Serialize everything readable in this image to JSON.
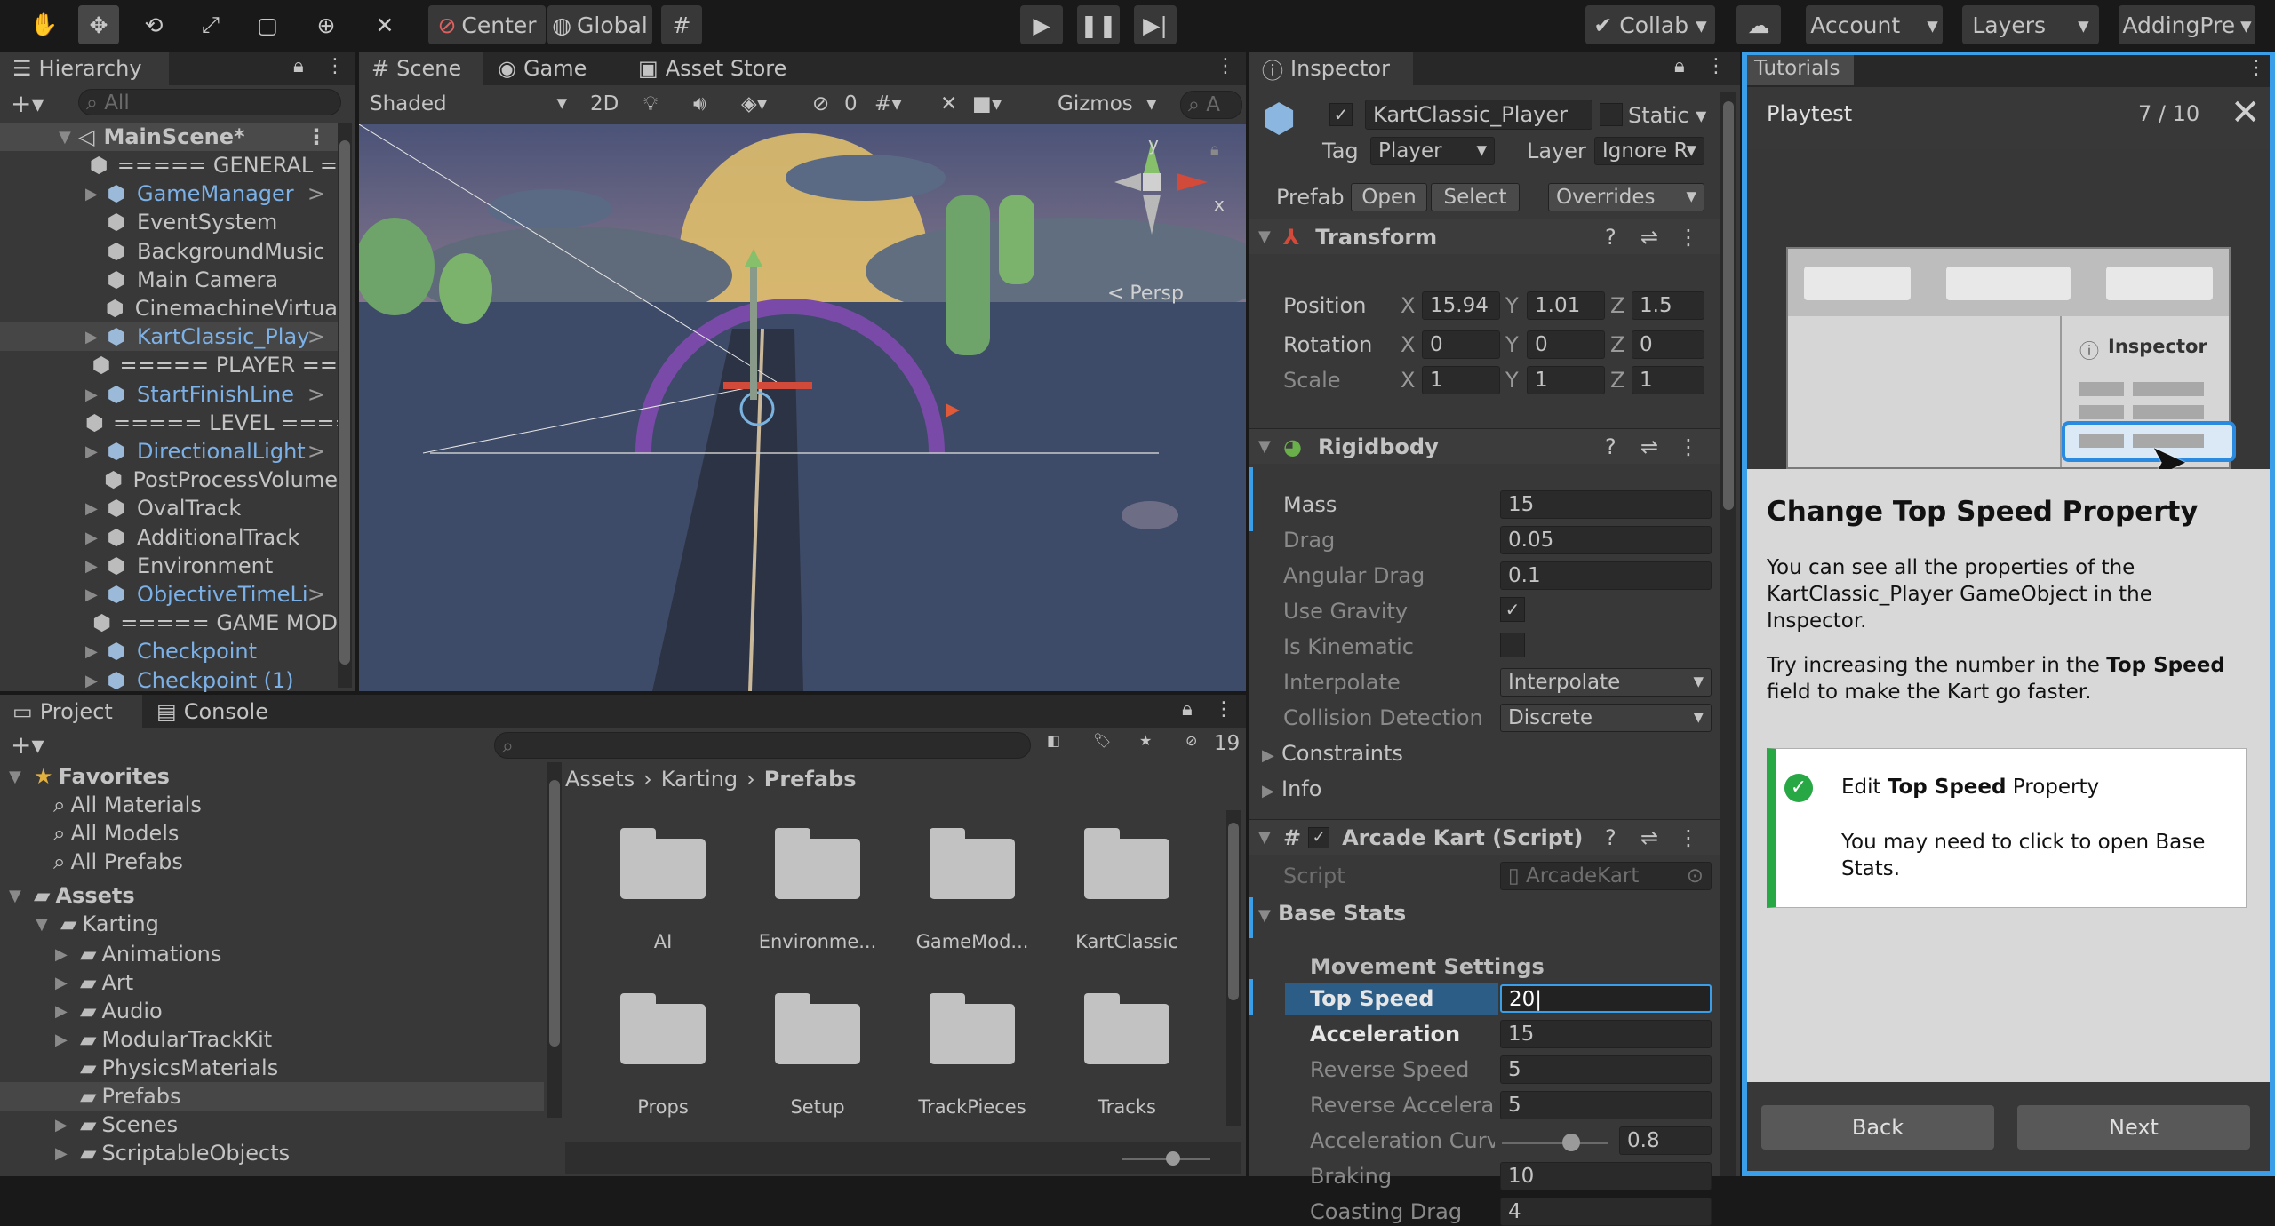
{
  "toolbar": {
    "center_label": "Center",
    "global_label": "Global",
    "collab_label": "Collab",
    "account_label": "Account",
    "layers_label": "Layers",
    "layout_label": "AddingPre"
  },
  "hierarchy": {
    "tab_label": "Hierarchy",
    "search_placeholder": "All",
    "scene_name": "MainScene*",
    "items": [
      {
        "label": "===== GENERAL =",
        "blue": false
      },
      {
        "label": "GameManager",
        "blue": true
      },
      {
        "label": "EventSystem",
        "blue": false
      },
      {
        "label": "BackgroundMusic",
        "blue": false
      },
      {
        "label": "Main Camera",
        "blue": false
      },
      {
        "label": "CinemachineVirtua",
        "blue": false
      },
      {
        "label": "KartClassic_Play",
        "blue": true
      },
      {
        "label": "===== PLAYER ==",
        "blue": false
      },
      {
        "label": "StartFinishLine",
        "blue": true
      },
      {
        "label": "===== LEVEL ====",
        "blue": false
      },
      {
        "label": "DirectionalLight",
        "blue": true
      },
      {
        "label": "PostProcessVolume",
        "blue": false
      },
      {
        "label": "OvalTrack",
        "blue": false
      },
      {
        "label": "AdditionalTrack",
        "blue": false
      },
      {
        "label": "Environment",
        "blue": false
      },
      {
        "label": "ObjectiveTimeLi",
        "blue": true
      },
      {
        "label": "===== GAME MOD",
        "blue": false
      },
      {
        "label": "Checkpoint",
        "blue": true
      },
      {
        "label": "Checkpoint (1)",
        "blue": true
      }
    ]
  },
  "scene": {
    "tab_scene": "Scene",
    "tab_game": "Game",
    "tab_asset_store": "Asset Store",
    "shading": "Shaded",
    "mode_2d": "2D",
    "hidden_count": "0",
    "gizmos": "Gizmos",
    "search_placeholder": "A",
    "persp": "< Persp",
    "axis_x": "x",
    "axis_y": "y"
  },
  "project": {
    "tab_project": "Project",
    "tab_console": "Console",
    "count": "19",
    "favorites_label": "Favorites",
    "favorites": [
      "All Materials",
      "All Models",
      "All Prefabs"
    ],
    "assets_label": "Assets",
    "karting_label": "Karting",
    "karting_children": [
      "Animations",
      "Art",
      "Audio",
      "ModularTrackKit",
      "PhysicsMaterials",
      "Prefabs",
      "Scenes",
      "ScriptableObjects"
    ],
    "breadcrumb": [
      "Assets",
      "Karting",
      "Prefabs"
    ],
    "folders": [
      "AI",
      "Environme...",
      "GameMod...",
      "KartClassic",
      "Props",
      "Setup",
      "TrackPieces",
      "Tracks"
    ]
  },
  "inspector": {
    "tab_label": "Inspector",
    "object_name": "KartClassic_Player",
    "static_label": "Static",
    "tag_label": "Tag",
    "tag_value": "Player",
    "layer_label": "Layer",
    "layer_value": "Ignore R",
    "prefab_label": "Prefab",
    "open_label": "Open",
    "select_label": "Select",
    "overrides_label": "Overrides",
    "transform_label": "Transform",
    "position_label": "Position",
    "rotation_label": "Rotation",
    "scale_label": "Scale",
    "position": {
      "x": "15.94",
      "y": "1.01",
      "z": "1.5"
    },
    "rotation": {
      "x": "0",
      "y": "0",
      "z": "0"
    },
    "scale": {
      "x": "1",
      "y": "1",
      "z": "1"
    },
    "axis_x": "X",
    "axis_y": "Y",
    "axis_z": "Z",
    "rigidbody_label": "Rigidbody",
    "rb": {
      "mass_label": "Mass",
      "mass": "15",
      "drag_label": "Drag",
      "drag": "0.05",
      "angular_drag_label": "Angular Drag",
      "angular_drag": "0.1",
      "use_gravity_label": "Use Gravity",
      "is_kinematic_label": "Is Kinematic",
      "interpolate_label": "Interpolate",
      "interpolate": "Interpolate",
      "collision_label": "Collision Detection",
      "collision": "Discrete",
      "constraints_label": "Constraints",
      "info_label": "Info"
    },
    "arcade_label": "Arcade Kart (Script)",
    "script_label": "Script",
    "script_value": "ArcadeKart",
    "base_stats_label": "Base Stats",
    "movement_label": "Movement Settings",
    "stats": [
      {
        "label": "Top Speed",
        "value": "20"
      },
      {
        "label": "Acceleration",
        "value": "15"
      },
      {
        "label": "Reverse Speed",
        "value": "5"
      },
      {
        "label": "Reverse Accelerat",
        "value": "5"
      },
      {
        "label": "Acceleration Curve",
        "value": "0.8"
      },
      {
        "label": "Braking",
        "value": "10"
      },
      {
        "label": "Coasting Drag",
        "value": "4"
      }
    ]
  },
  "tutorial": {
    "tab_label": "Tutorials",
    "section": "Playtest",
    "progress": "7 / 10",
    "mock_inspector_label": "Inspector",
    "heading": "Change Top Speed Property",
    "para1": "You can see all the properties of the KartClassic_Player GameObject in the Inspector.",
    "para2_pre": "Try increasing the number in the ",
    "para2_bold": "Top Speed",
    "para2_post": " field to make the Kart go faster.",
    "task_pre": "Edit ",
    "task_bold": "Top Speed",
    "task_post": " Property",
    "task_hint": "You may need to click to open Base Stats.",
    "back_label": "Back",
    "next_label": "Next"
  },
  "colors": {
    "accent": "#3a9fe8",
    "blue_text": "#7cb1e8",
    "check_green": "#28a745",
    "tutorial_blue": "#0e74c8"
  }
}
